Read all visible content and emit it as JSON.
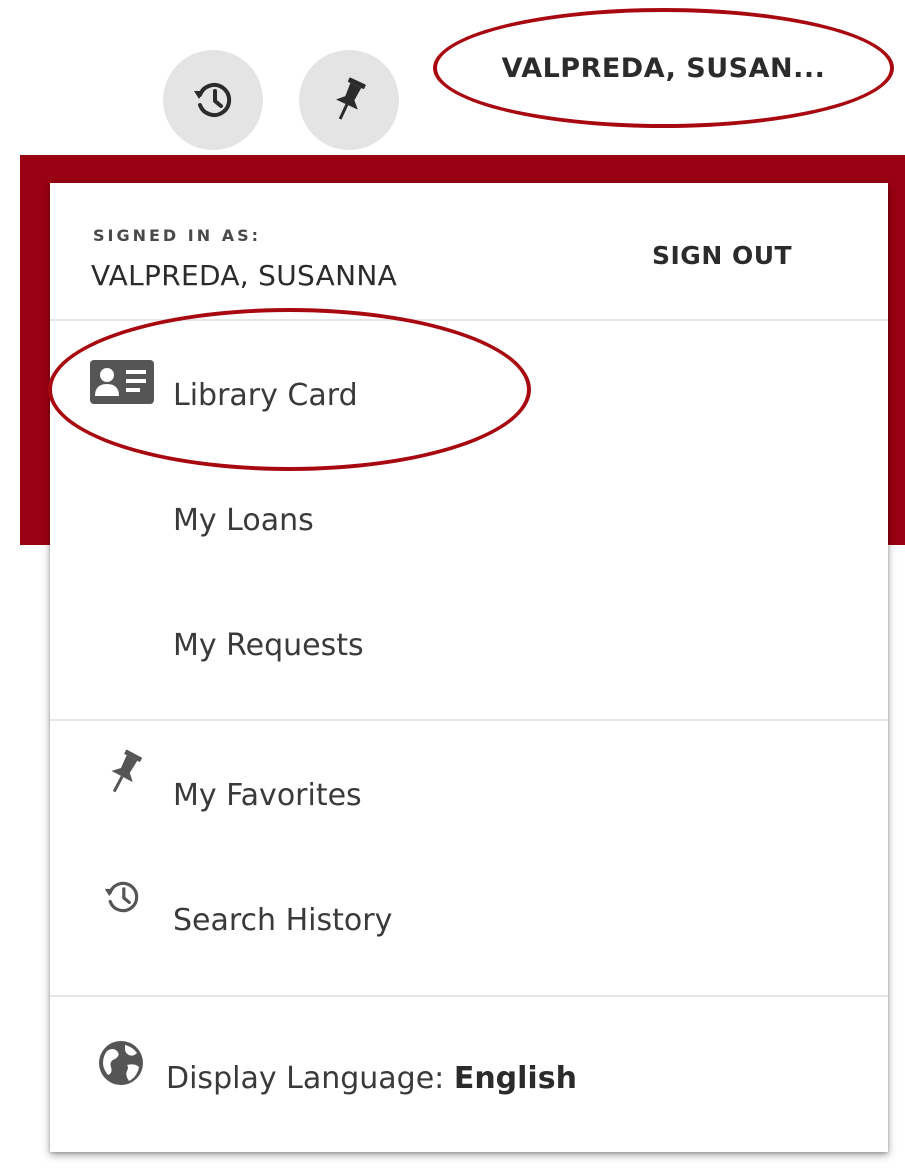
{
  "toolbar": {
    "history_icon": "history-icon",
    "pin_icon": "pin-icon",
    "user_menu_label": "VALPREDA, SUSAN..."
  },
  "colors": {
    "header_band": "#990012",
    "annotation": "#a8080f",
    "toolbar_button": "#e4e4e4"
  },
  "user_menu": {
    "signed_in_caption": "SIGNED IN AS:",
    "user_name": "VALPREDA, SUSANNA",
    "sign_out_label": "SIGN OUT",
    "items": [
      {
        "label": "Library Card",
        "icon": "id-card-icon"
      },
      {
        "label": "My Loans"
      },
      {
        "label": "My Requests"
      },
      {
        "label": "My Favorites",
        "icon": "pin-icon"
      },
      {
        "label": "Search History",
        "icon": "history-icon"
      }
    ],
    "language": {
      "label": "Display Language:",
      "value": "English",
      "icon": "globe-icon"
    }
  }
}
